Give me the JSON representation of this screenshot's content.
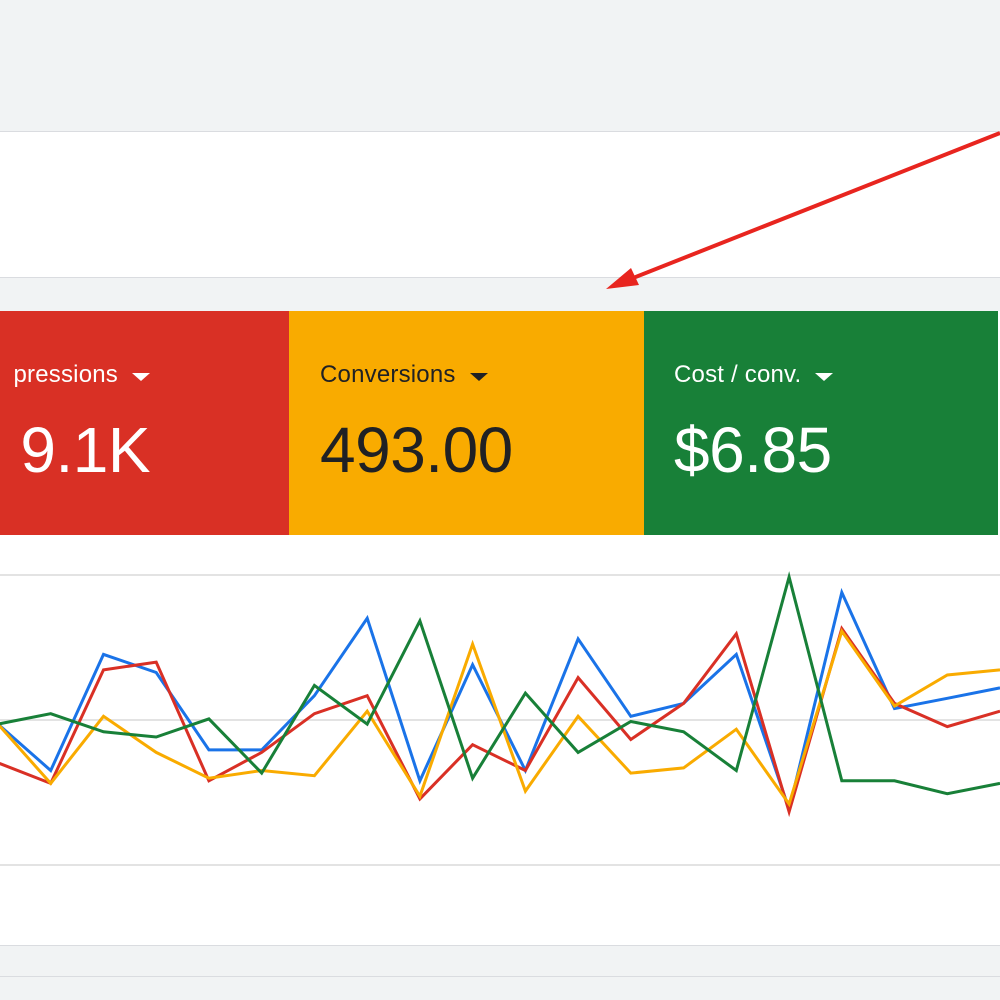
{
  "scorecards": [
    {
      "id": "impressions",
      "label": "pressions",
      "value": "9.1K",
      "color": "#d93025",
      "text_color": "#ffffff"
    },
    {
      "id": "conversions",
      "label": "Conversions",
      "value": "493.00",
      "color": "#f9ab00",
      "text_color": "#202124"
    },
    {
      "id": "cost",
      "label": "Cost / conv.",
      "value": "$6.85",
      "color": "#188038",
      "text_color": "#ffffff"
    }
  ],
  "annotation": {
    "type": "arrow",
    "color": "#e8251f"
  },
  "chart_data": {
    "type": "line",
    "x": [
      0,
      1,
      2,
      3,
      4,
      5,
      6,
      7,
      8,
      9,
      10,
      11,
      12,
      13,
      14,
      15,
      16,
      17,
      18,
      19
    ],
    "ylim": [
      0,
      100
    ],
    "grid": true,
    "series": [
      {
        "color": "#1a73e8",
        "values": [
          43,
          25,
          70,
          63,
          33,
          33,
          54,
          84,
          21,
          66,
          25,
          76,
          46,
          51,
          70,
          10,
          94,
          49,
          53,
          57
        ]
      },
      {
        "color": "#d93025",
        "values": [
          28,
          20,
          64,
          67,
          21,
          32,
          47,
          54,
          14,
          35,
          25,
          61,
          37,
          51,
          78,
          9,
          80,
          51,
          42,
          48
        ]
      },
      {
        "color": "#f9ab00",
        "values": [
          43,
          20,
          46,
          32,
          22,
          25,
          23,
          48,
          15,
          74,
          17,
          46,
          24,
          26,
          41,
          12,
          79,
          50,
          62,
          64
        ]
      },
      {
        "color": "#188038",
        "values": [
          43,
          47,
          40,
          38,
          45,
          24,
          58,
          43,
          83,
          22,
          55,
          32,
          44,
          40,
          25,
          100,
          21,
          21,
          16,
          20
        ]
      }
    ]
  }
}
